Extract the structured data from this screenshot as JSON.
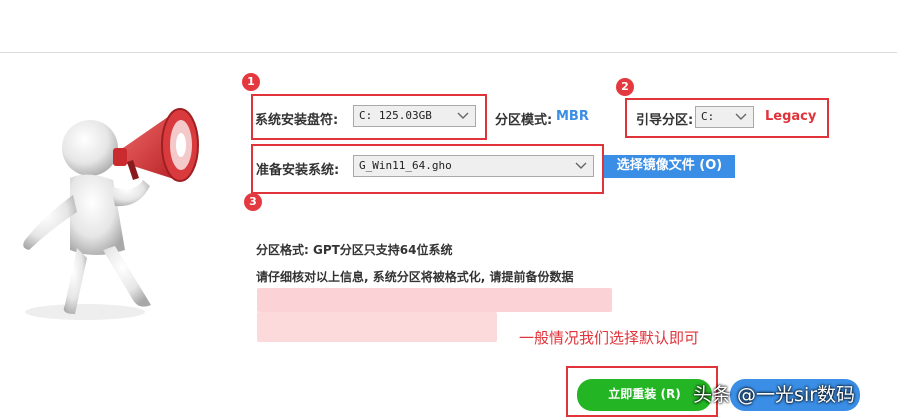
{
  "form": {
    "drive_label": "系统安装盘符:",
    "drive_value": "C: 125.03GB",
    "partition_mode_label": "分区模式:",
    "partition_mode_value": "MBR",
    "boot_label": "引导分区:",
    "boot_value": "C:",
    "boot_mode": "Legacy",
    "system_label": "准备安装系统:",
    "system_value": "G_Win11_64.gho",
    "choose_image_button": "选择镜像文件 (O)"
  },
  "info": {
    "partition_format": "分区格式: GPT分区只支持64位系统",
    "warning": "请仔细核对以上信息, 系统分区将被格式化, 请提前备份数据"
  },
  "annotation": {
    "note": "一般情况我们选择默认即可",
    "badges": [
      "1",
      "2",
      "3"
    ]
  },
  "buttons": {
    "reinstall": "立即重装 (R)"
  },
  "watermark": {
    "text": "头条 @一光sir数码"
  },
  "colors": {
    "annotation_red": "#e0333a",
    "accent_blue": "#3a8ee6",
    "button_green": "#23b524"
  }
}
